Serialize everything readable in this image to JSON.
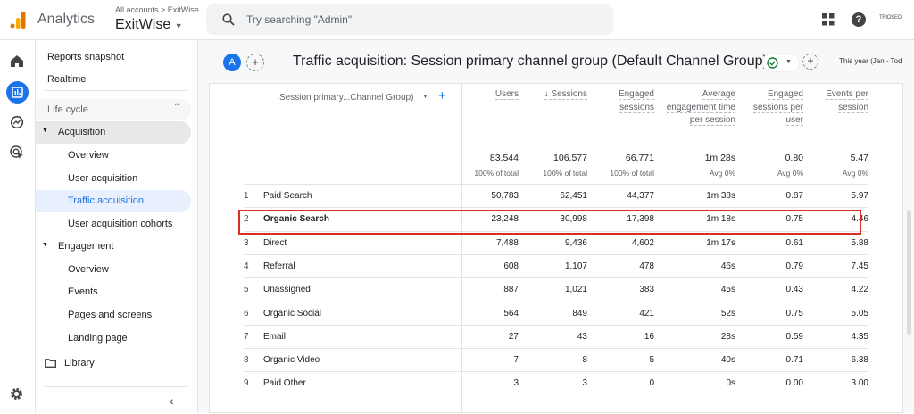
{
  "topbar": {
    "product": "Analytics",
    "breadcrumb": "All accounts > ExitWise",
    "property": "ExitWise",
    "search_placeholder": "Try searching \"Admin\"",
    "account_badge": "TRIOSEO"
  },
  "nav": {
    "items": [
      {
        "label": "Reports snapshot",
        "level": 0
      },
      {
        "label": "Realtime",
        "level": 0
      },
      {
        "label": "Life cycle",
        "level": "section"
      },
      {
        "label": "Acquisition",
        "level": 1,
        "expanded": true
      },
      {
        "label": "Overview",
        "level": 2
      },
      {
        "label": "User acquisition",
        "level": 2
      },
      {
        "label": "Traffic acquisition",
        "level": 2,
        "selected": true
      },
      {
        "label": "User acquisition cohorts",
        "level": 2
      },
      {
        "label": "Engagement",
        "level": 1,
        "expanded": true
      },
      {
        "label": "Overview",
        "level": 2
      },
      {
        "label": "Events",
        "level": 2
      },
      {
        "label": "Pages and screens",
        "level": 2
      },
      {
        "label": "Landing page",
        "level": 2
      },
      {
        "label": "Library",
        "level": "library"
      }
    ]
  },
  "report": {
    "segment": "A",
    "title": "Traffic acquisition: Session primary channel group (Default Channel Group)",
    "date_range": "This year (Jan - Tod",
    "accent": "#1a73e8",
    "highlight": "#d93025"
  },
  "table": {
    "dimension_header": "Session primary...Channel Group)",
    "columns": [
      "Users",
      "↓ Sessions",
      "Engaged sessions",
      "Average engagement time per session",
      "Engaged sessions per user",
      "Events per session"
    ],
    "totals": [
      "83,544",
      "106,577",
      "66,771",
      "1m 28s",
      "0.80",
      "5.47"
    ],
    "totals_sub": [
      "100% of total",
      "100% of total",
      "100% of total",
      "Avg 0%",
      "Avg 0%",
      "Avg 0%"
    ],
    "rows": [
      {
        "n": "1",
        "channel": "Paid Search",
        "values": [
          "50,783",
          "62,451",
          "44,377",
          "1m 38s",
          "0.87",
          "5.97"
        ]
      },
      {
        "n": "2",
        "channel": "Organic Search",
        "values": [
          "23,248",
          "30,998",
          "17,398",
          "1m 18s",
          "0.75",
          "4.46"
        ],
        "highlighted": true
      },
      {
        "n": "3",
        "channel": "Direct",
        "values": [
          "7,488",
          "9,436",
          "4,602",
          "1m 17s",
          "0.61",
          "5.88"
        ]
      },
      {
        "n": "4",
        "channel": "Referral",
        "values": [
          "608",
          "1,107",
          "478",
          "46s",
          "0.79",
          "7.45"
        ]
      },
      {
        "n": "5",
        "channel": "Unassigned",
        "values": [
          "887",
          "1,021",
          "383",
          "45s",
          "0.43",
          "4.22"
        ]
      },
      {
        "n": "6",
        "channel": "Organic Social",
        "values": [
          "564",
          "849",
          "421",
          "52s",
          "0.75",
          "5.05"
        ]
      },
      {
        "n": "7",
        "channel": "Email",
        "values": [
          "27",
          "43",
          "16",
          "28s",
          "0.59",
          "4.35"
        ]
      },
      {
        "n": "8",
        "channel": "Organic Video",
        "values": [
          "7",
          "8",
          "5",
          "40s",
          "0.71",
          "6.38"
        ]
      },
      {
        "n": "9",
        "channel": "Paid Other",
        "values": [
          "3",
          "3",
          "0",
          "0s",
          "0.00",
          "3.00"
        ]
      }
    ]
  }
}
